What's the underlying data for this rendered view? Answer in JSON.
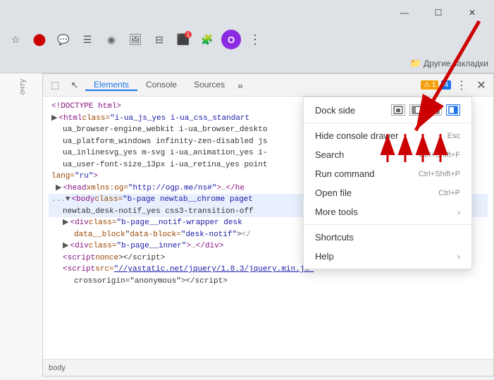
{
  "titleBar": {
    "minimize": "—",
    "maximize": "☐",
    "close": "✕"
  },
  "navbar": {
    "bookmarksFolderIcon": "📁",
    "otherBookmarks": "Другие закладки"
  },
  "devtools": {
    "tabs": [
      {
        "label": "Elements",
        "active": true
      },
      {
        "label": "Console",
        "active": false
      },
      {
        "label": "Sources",
        "active": false
      },
      {
        "label": "»",
        "active": false
      }
    ],
    "badge_warning": "⚠ 1",
    "badge_info": "4",
    "menuIcon": "⋮",
    "closeIcon": "✕",
    "htmlContent": [
      "<!DOCTYPE html>",
      "<html class=\"i-ua_js_yes i-ua_css_standart",
      "ua_browser-engine_webkit i-ua_browser_deskto",
      "ua_platform_windows infinity-zen-disabled js",
      "ua_inlinesvg_yes m-svg i-ua_animation_yes i-",
      "ua_user-font-size_13px i-ua_retina_yes point",
      "lang=\"ru\">"
    ],
    "footerText": "body"
  },
  "dropdownMenu": {
    "dockSide": {
      "label": "Dock side",
      "icons": [
        "undock",
        "dock-left",
        "dock-bottom",
        "dock-right"
      ]
    },
    "items": [
      {
        "label": "Hide console drawer",
        "shortcut": "Esc",
        "arrow": false
      },
      {
        "label": "Search",
        "shortcut": "Ctrl+Shift+F",
        "arrow": false
      },
      {
        "label": "Run command",
        "shortcut": "Ctrl+Shift+P",
        "arrow": false
      },
      {
        "label": "Open file",
        "shortcut": "Ctrl+P",
        "arrow": false
      },
      {
        "label": "More tools",
        "shortcut": "",
        "arrow": true
      },
      {
        "label": "Shortcuts",
        "shortcut": "",
        "arrow": false
      },
      {
        "label": "Help",
        "shortcut": "",
        "arrow": true
      }
    ]
  },
  "icons": {
    "inspector": "⬜",
    "cursor": "↖",
    "star": "☆",
    "opera": "O",
    "folder_icon": "📁",
    "bookmark_arrow": "»"
  }
}
